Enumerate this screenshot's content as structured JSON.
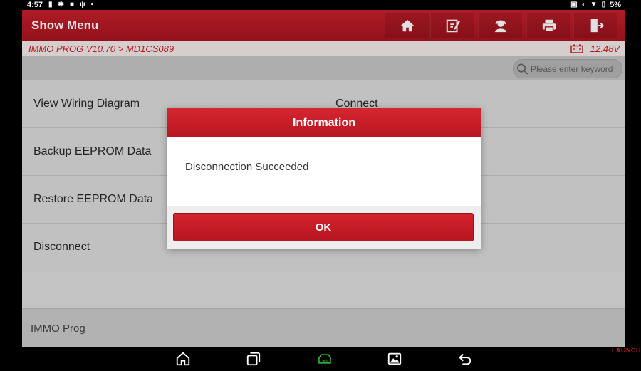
{
  "status_bar": {
    "time": "4:57",
    "battery": "5%",
    "left_icons": [
      "battery-saver-icon",
      "settings-icon",
      "video-icon",
      "usb-icon",
      "dot-icon"
    ],
    "right_icons": [
      "cast-icon",
      "alarm-icon",
      "wifi-icon",
      "battery-icon"
    ]
  },
  "header": {
    "title": "Show Menu",
    "toolbar_icons": [
      "home-icon",
      "edit-icon",
      "user-support-icon",
      "print-icon",
      "exit-icon"
    ]
  },
  "breadcrumb": {
    "path": "IMMO PROG V10.70 > MD1CS089",
    "voltage": "12.48V"
  },
  "search": {
    "placeholder": "Please enter keyword"
  },
  "menu": {
    "items": [
      {
        "label": "View Wiring Diagram"
      },
      {
        "label": "Connect"
      },
      {
        "label": "Backup EEPROM Data"
      },
      {
        "label": "Restore EEPROM Data"
      },
      {
        "label": "Disconnect"
      }
    ]
  },
  "footer": {
    "label": "IMMO Prog"
  },
  "dialog": {
    "title": "Information",
    "message": "Disconnection Succeeded",
    "ok_label": "OK"
  },
  "nav_bar": {
    "icons": [
      "home-icon",
      "recent-apps-icon",
      "vci-icon",
      "gallery-icon",
      "back-icon"
    ],
    "vci_label": "VCI"
  },
  "watermark": "LAUNCH",
  "colors": {
    "brand_red": "#c8202c",
    "vci_green": "#3fbf3f"
  }
}
